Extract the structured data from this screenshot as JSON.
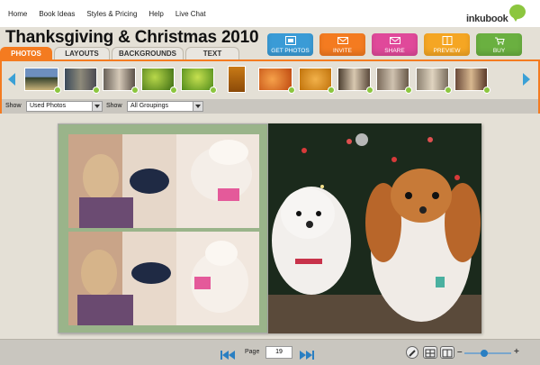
{
  "nav": {
    "links": [
      "Home",
      "Book Ideas",
      "Styles & Pricing",
      "Help",
      "Live Chat"
    ]
  },
  "logo": {
    "text": "inkubook"
  },
  "title": "Thanksgiving & Christmas 2010",
  "actions": [
    {
      "label": "GET PHOTOS",
      "color": "#3a9bd6",
      "icon": "photos-icon"
    },
    {
      "label": "INVITE",
      "color": "#f47b20",
      "icon": "invite-icon"
    },
    {
      "label": "SHARE",
      "color": "#e0499a",
      "icon": "share-icon"
    },
    {
      "label": "PREVIEW",
      "color": "#f5a623",
      "icon": "preview-icon"
    },
    {
      "label": "BUY",
      "color": "#6ab040",
      "icon": "cart-icon"
    }
  ],
  "tabs": [
    "PHOTOS",
    "LAYOUTS",
    "BACKGROUNDS",
    "TEXT"
  ],
  "filters": {
    "show_label": "Show",
    "used_photos": "Used Photos",
    "groupings": "All Groupings"
  },
  "pager": {
    "page_label": "Page",
    "page_value": "19"
  },
  "colors": {
    "accent": "#f47b20",
    "nav_blue": "#2a7fc2",
    "check_green": "#8cc63f"
  }
}
